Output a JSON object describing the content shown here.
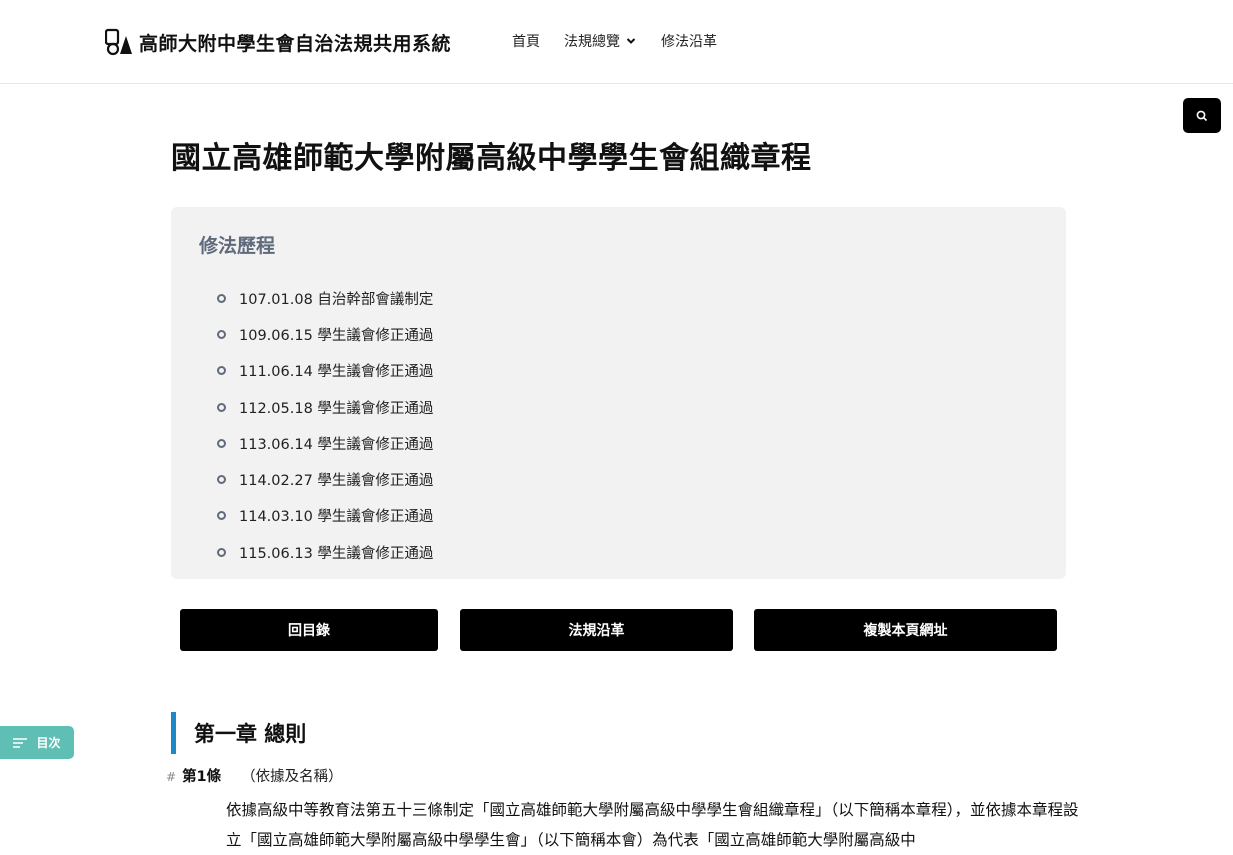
{
  "header": {
    "site_title": "高師大附中學生會自治法規共用系統",
    "nav": [
      {
        "label": "首頁"
      },
      {
        "label": "法規總覽"
      },
      {
        "label": "修法沿革"
      }
    ]
  },
  "page": {
    "title": "國立高雄師範大學附屬高級中學學生會組織章程"
  },
  "history": {
    "title": "修法歷程",
    "items": [
      "107.01.08 自治幹部會議制定",
      "109.06.15 學生議會修正通過",
      "111.06.14 學生議會修正通過",
      "112.05.18 學生議會修正通過",
      "113.06.14 學生議會修正通過",
      "114.02.27 學生議會修正通過",
      "114.03.10 學生議會修正通過",
      "115.06.13 學生議會修正通過"
    ]
  },
  "buttons": {
    "back": "回目錄",
    "history": "法規沿革",
    "copy": "複製本頁網址"
  },
  "toc": {
    "label": "目次"
  },
  "chapter": {
    "title": "第一章 總則"
  },
  "article": {
    "hash": "#",
    "number": "第1條",
    "subtitle": "（依據及名稱）",
    "body": "依據高級中等教育法第五十三條制定「國立高雄師範大學附屬高級中學學生會組織章程」（以下簡稱本章程），並依據本章程設立「國立高雄師範大學附屬高級中學學生會」（以下簡稱本會）為代表「國立高雄師範大學附屬高級中"
  },
  "colors": {
    "chapter_accent": "#1e88c8",
    "toc_button": "#5fbfb4",
    "history_bg": "#f2f2f2",
    "history_title": "#5f6b7d"
  },
  "icons": [
    "logo-icon",
    "chevron-down-icon",
    "search-icon",
    "menu-lines-icon"
  ]
}
